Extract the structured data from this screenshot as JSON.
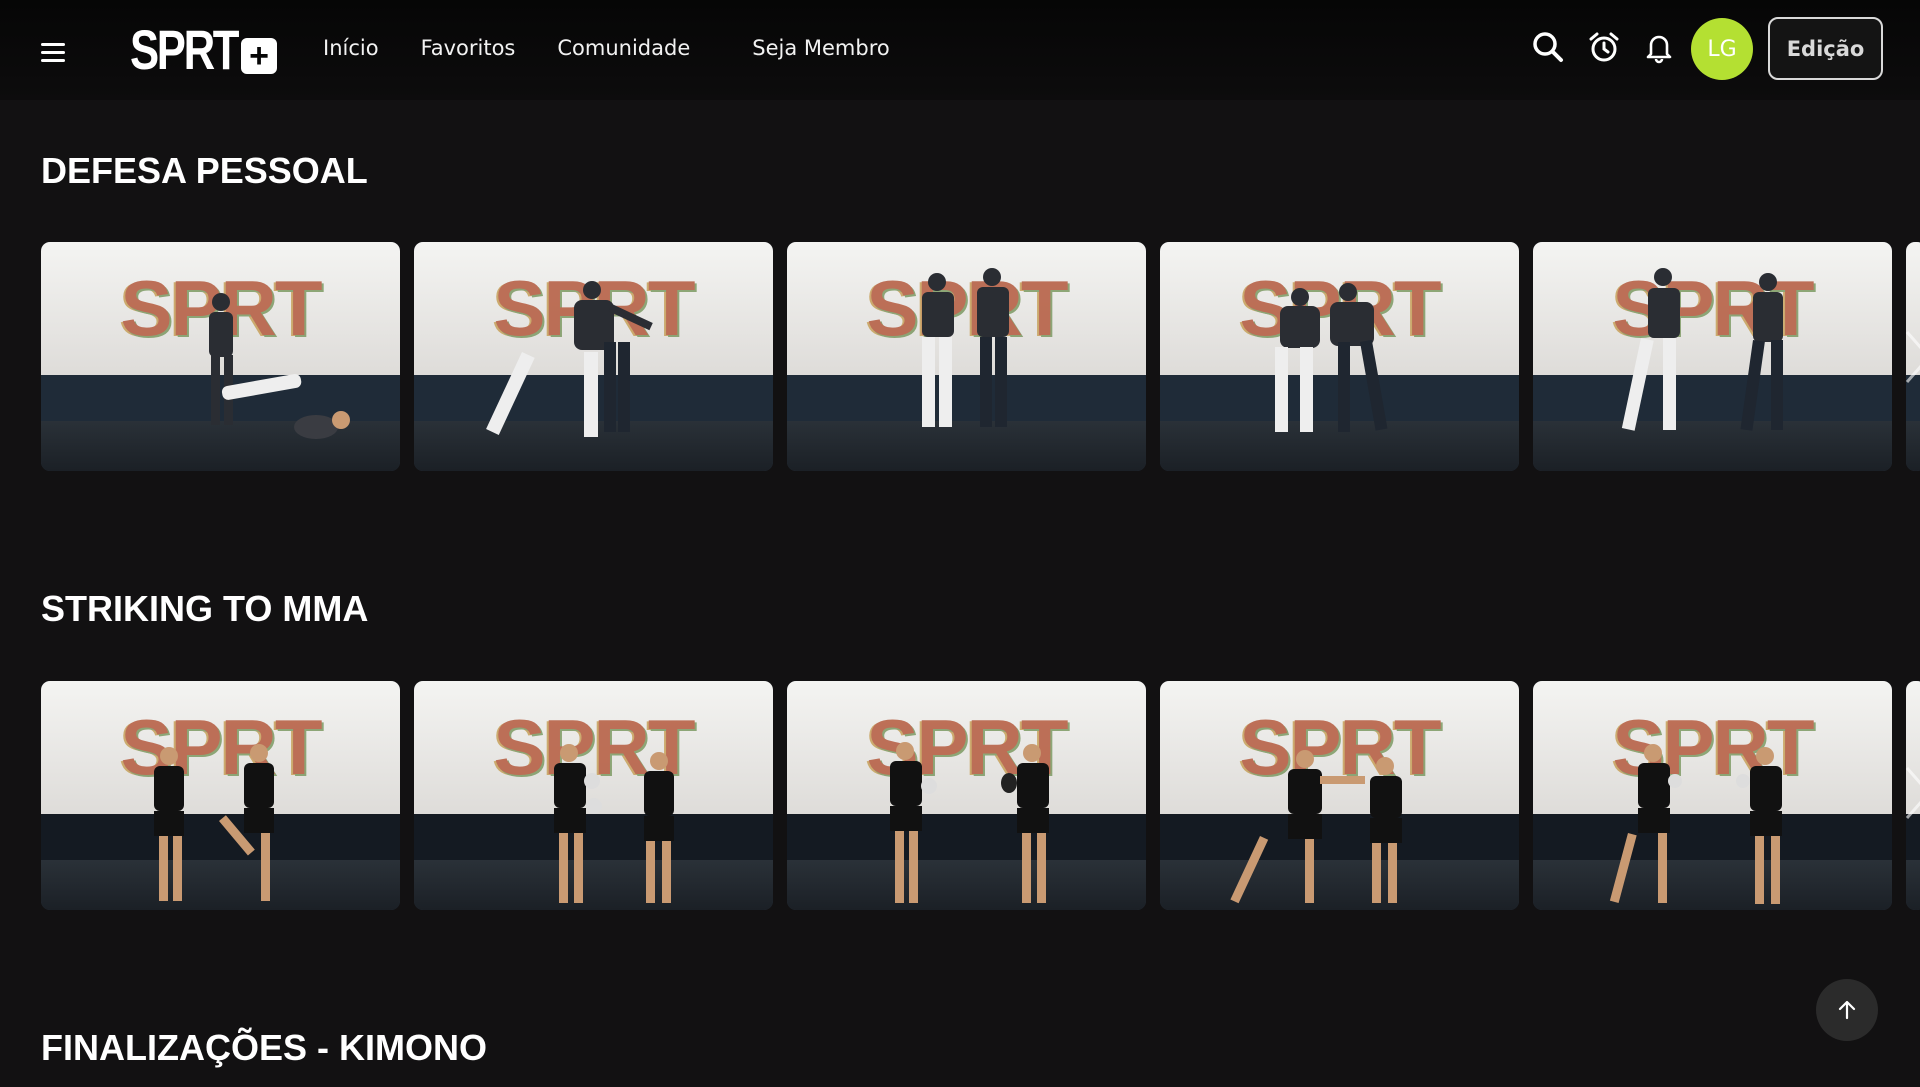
{
  "header": {
    "logo_text": "SPRT",
    "logo_plus": "+",
    "nav": [
      "Início",
      "Favoritos",
      "Comunidade",
      "Seja Membro"
    ],
    "avatar_initials": "LG",
    "edit_label": "Edição",
    "icons": [
      "menu-icon",
      "search-icon",
      "alarm-clock-icon",
      "bell-icon",
      "arrow-up-icon",
      "chevron-right-icon"
    ],
    "colors": {
      "avatar": "#b4e032",
      "background": "#121112"
    }
  },
  "sections": [
    {
      "title": "DEFESA PESSOAL",
      "thumbnail_mural": "SPRT"
    },
    {
      "title": "STRIKING TO MMA",
      "thumbnail_mural": "SPRT"
    },
    {
      "title": "FINALIZAÇÕES - KIMONO"
    }
  ]
}
